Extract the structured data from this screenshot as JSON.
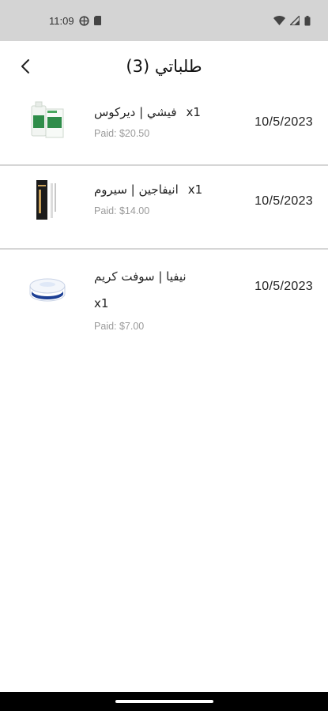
{
  "status": {
    "time": "11:09"
  },
  "header": {
    "title": "طلباتي (3)"
  },
  "orders": [
    {
      "name": "فيشي | ديركوس",
      "qty": "x1",
      "paid": "Paid: $20.50",
      "date": "10/5/2023",
      "image": "hair-product-box-icon"
    },
    {
      "name": "انيفاجين | سيروم",
      "qty": "x1",
      "paid": "Paid: $14.00",
      "date": "10/5/2023",
      "image": "serum-box-icon"
    },
    {
      "name": "نيفيا | سوفت كريم",
      "qty": "x1",
      "paid": "Paid: $7.00",
      "date": "10/5/2023",
      "image": "cream-jar-icon"
    }
  ],
  "colors": {
    "status_bar": "#d4d4d4",
    "divider": "#d6d6d6",
    "muted_text": "#9a9a9a",
    "nav_bar": "#000000"
  }
}
